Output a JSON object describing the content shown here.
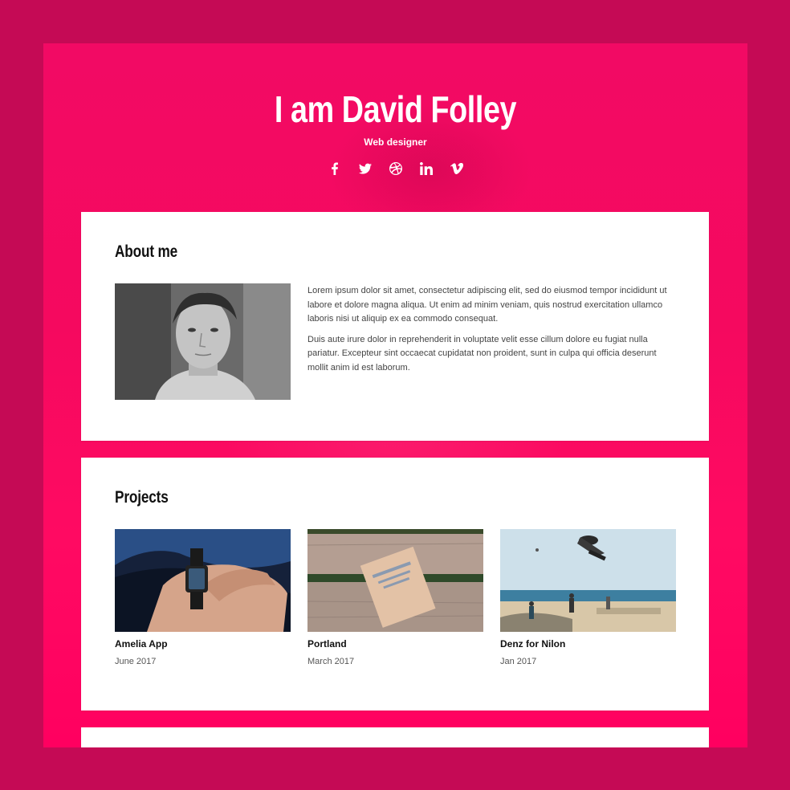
{
  "hero": {
    "title": "I am David Folley",
    "subtitle": "Web designer",
    "social": [
      "facebook-icon",
      "twitter-icon",
      "dribbble-icon",
      "linkedin-icon",
      "vimeo-icon"
    ]
  },
  "about": {
    "title": "About me",
    "paragraphs": [
      "Lorem ipsum dolor sit amet, consectetur adipiscing elit, sed do eiusmod tempor incididunt ut labore et dolore magna aliqua. Ut enim ad minim veniam, quis nostrud exercitation ullamco laboris nisi ut aliquip ex ea commodo consequat.",
      "Duis aute irure dolor in reprehenderit in voluptate velit esse cillum dolore eu fugiat nulla pariatur. Excepteur sint occaecat cupidatat non proident, sunt in culpa qui officia deserunt mollit anim id est laborum."
    ]
  },
  "projects": {
    "title": "Projects",
    "items": [
      {
        "name": "Amelia App",
        "date": "June 2017"
      },
      {
        "name": "Portland",
        "date": "March 2017"
      },
      {
        "name": "Denz for Nilon",
        "date": "Jan 2017"
      }
    ]
  },
  "colors": {
    "background": "#c50a55",
    "accent": "#ff0a62",
    "card": "#ffffff"
  }
}
